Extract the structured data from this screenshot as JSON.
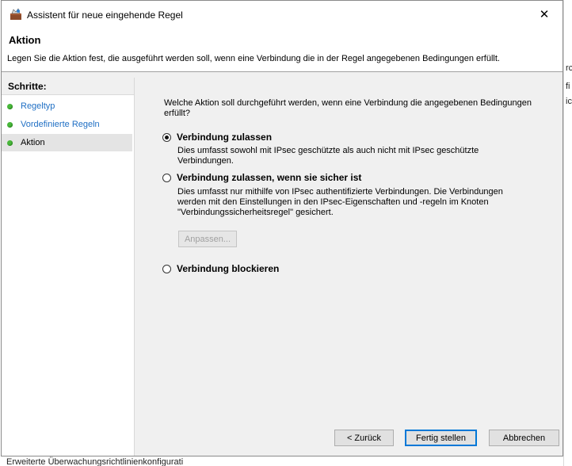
{
  "window": {
    "title": "Assistent für neue eingehende Regel",
    "close_glyph": "✕"
  },
  "header": {
    "title": "Aktion",
    "description": "Legen Sie die Aktion fest, die ausgeführt werden soll, wenn eine Verbindung die in der Regel angegebenen Bedingungen erfüllt."
  },
  "steps": {
    "title": "Schritte:",
    "items": [
      {
        "label": "Regeltyp"
      },
      {
        "label": "Vordefinierte Regeln"
      },
      {
        "label": "Aktion"
      }
    ]
  },
  "main": {
    "question": "Welche Aktion soll durchgeführt werden, wenn eine Verbindung die angegebenen Bedingungen erfüllt?",
    "options": [
      {
        "label": "Verbindung zulassen",
        "description": "Dies umfasst sowohl mit IPsec geschützte als auch nicht mit IPsec geschützte Verbindungen.",
        "selected": true
      },
      {
        "label": "Verbindung zulassen, wenn sie sicher ist",
        "description": "Dies umfasst nur mithilfe von IPsec authentifizierte Verbindungen. Die Verbindungen werden mit den Einstellungen in den IPsec-Eigenschaften und -regeln im Knoten \"Verbindungssicherheitsregel\" gesichert.",
        "selected": false
      },
      {
        "label": "Verbindung blockieren",
        "selected": false
      }
    ],
    "customize_button": "Anpassen..."
  },
  "footer": {
    "back": "< Zurück",
    "finish": "Fertig stellen",
    "cancel": "Abbrechen"
  },
  "background": {
    "fragments": [
      "rc",
      "fi",
      "ic"
    ],
    "bottom_text": "Erweiterte Überwachungsrichtlinienkonfigurati"
  },
  "colors": {
    "accent": "#0078d7",
    "step_dot": "#49b83b",
    "link": "#1f6fc4"
  }
}
